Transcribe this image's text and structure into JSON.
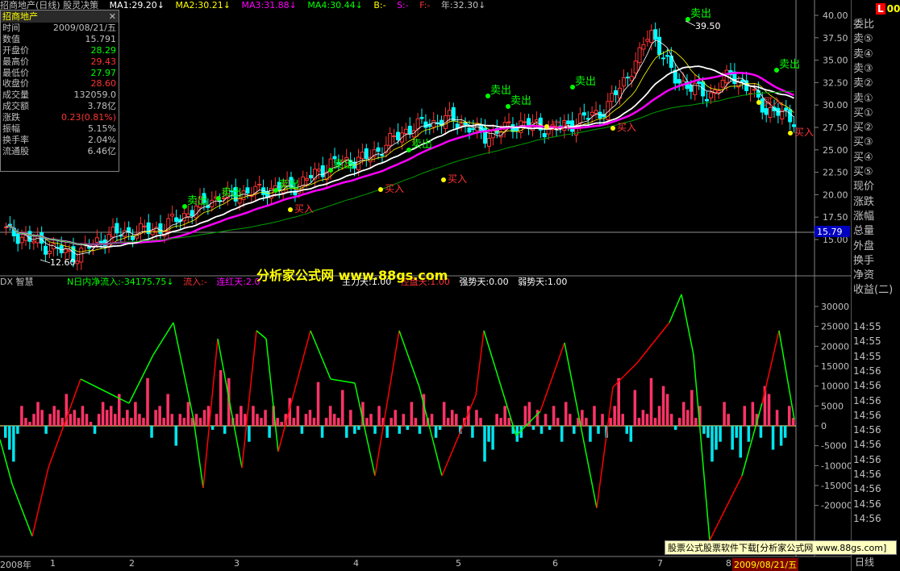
{
  "topbar": {
    "title": "招商地产(日线) 股灵决策",
    "ma1": "MA1:29.20↓",
    "ma2": "MA2:30.21↓",
    "ma3": "MA3:31.88↓",
    "ma4": "MA4:30.44↓",
    "b": "B:-",
    "s": "S:-",
    "f": "F:-",
    "year": "年:32.30↓"
  },
  "colors": {
    "ma1": "#ffffff",
    "ma2": "#ffff00",
    "ma3": "#ff00ff",
    "ma4": "#00ff00",
    "up": "#ff3333",
    "down": "#00ffff",
    "sell_label": "#00ff00",
    "buy_label": "#ff3333"
  },
  "info_panel": {
    "title": "招商地产",
    "close_icon": "close-icon",
    "rows": [
      {
        "label": "时间",
        "value": "2009/08/21/五",
        "color": "#c0c0c0"
      },
      {
        "label": "数值",
        "value": "15.791",
        "color": "#c0c0c0"
      },
      {
        "label": "开盘价",
        "value": "28.29",
        "color": "#00ff00"
      },
      {
        "label": "最高价",
        "value": "29.43",
        "color": "#ff3333"
      },
      {
        "label": "最低价",
        "value": "27.97",
        "color": "#00ff00"
      },
      {
        "label": "收盘价",
        "value": "28.60",
        "color": "#ff3333"
      },
      {
        "label": "成交量",
        "value": "132059.0",
        "color": "#c0c0c0"
      },
      {
        "label": "成交额",
        "value": "3.78亿",
        "color": "#c0c0c0"
      },
      {
        "label": "涨跌",
        "value": "0.23(0.81%)",
        "color": "#ff3333"
      },
      {
        "label": "振幅",
        "value": "5.15%",
        "color": "#c0c0c0"
      },
      {
        "label": "换手率",
        "value": "2.04%",
        "color": "#c0c0c0"
      },
      {
        "label": "流通股",
        "value": "6.46亿",
        "color": "#c0c0c0"
      }
    ]
  },
  "right_panel": {
    "top_label": "00",
    "items": [
      "委比",
      "卖⑤",
      "卖④",
      "卖③",
      "卖②",
      "卖①",
      "买①",
      "买②",
      "买③",
      "买④",
      "买⑤",
      "现价",
      "涨跌",
      "涨幅",
      "总量",
      "外盘",
      "换手",
      "净资",
      "收益(二)"
    ],
    "times": [
      "14:55",
      "14:55",
      "14:55",
      "14:56",
      "14:56",
      "14:56",
      "14:56",
      "14:56",
      "14:56",
      "14:56",
      "14:56",
      "14:56",
      "14:56",
      "14:56"
    ],
    "bottom": "日线"
  },
  "price_axis": {
    "ticks": [
      "40.00",
      "37.50",
      "35.00",
      "32.50",
      "30.00",
      "27.50",
      "25.00",
      "22.50",
      "20.00",
      "17.50",
      "15.00"
    ],
    "current": "15.79"
  },
  "flow_axis": {
    "ticks": [
      "30000",
      "25000",
      "20000",
      "15000",
      "10000",
      "5000",
      "0",
      "-5000",
      "-10000",
      "-15000",
      "-20000"
    ]
  },
  "price_chart": {
    "high_label": "39.50",
    "low_label": "12.60",
    "sell_text": "卖出",
    "buy_text": "买入",
    "price_min": 12.6,
    "price_max": 40.0
  },
  "dx_panel": {
    "name": "DX 智慧",
    "n_flow": "N日内净流入:-34175.75↓",
    "inflow": "流入:-",
    "red_days": "连红天:2.0",
    "main_force": "主力天:1.00",
    "ctrl_days": "控盘天:1.00",
    "strong_days": "强势天:0.00",
    "weak_days": "弱势天:1.00"
  },
  "watermark": "分析家公式网 www.88gs.com",
  "footer_ad": "股票公式股票软件下载[分析家公式网 www.88gs.com]",
  "x_axis": {
    "labels": [
      "2008年",
      "1",
      "2",
      "3",
      "4",
      "5",
      "6",
      "7",
      "8",
      "2009/08/21/五"
    ]
  },
  "chart_data": {
    "type": "bar",
    "title": "",
    "categories": [],
    "series": [
      {
        "name": "流入",
        "values": [
          -3000,
          -6000,
          -9000,
          -2000,
          5000,
          2000,
          1000,
          3000,
          6000,
          4000,
          -2000,
          3000,
          5000,
          4000,
          2000,
          8000,
          3000,
          4000,
          2000,
          5000,
          3000,
          1000,
          -2000,
          3000,
          6000,
          4000,
          5000,
          3000,
          8000,
          2000,
          4000,
          2000,
          6000,
          3000,
          2000,
          12000,
          -3000,
          4000,
          5000,
          2000,
          8000,
          3000,
          -5000,
          3000,
          2000,
          6000,
          2000,
          3000,
          2000,
          4000,
          5000,
          -1000,
          3000,
          14000,
          -2000,
          12000,
          2000,
          3000,
          5000,
          3000,
          -4000,
          5000,
          3000,
          2000,
          4000,
          -3000,
          5000,
          2000,
          1000,
          3000,
          7000,
          2000,
          5000,
          -2000,
          3000,
          4000,
          2000,
          11000,
          -3000,
          2000,
          5000,
          3000,
          2000,
          9000,
          -3000,
          4000,
          -2000,
          -1000,
          6000,
          2000,
          3000,
          -2000,
          5000,
          2000,
          -3000,
          2000,
          4000,
          -2000,
          3000,
          -1000,
          6000,
          2000,
          -2000,
          8000,
          2000,
          3000,
          -3000,
          -1000,
          6000,
          2000,
          4000,
          3000,
          -2000,
          2000,
          5000,
          -3000,
          4000,
          2000,
          -9000,
          -4000,
          -6000,
          3000,
          2000,
          5000,
          2000,
          -2000,
          -4000,
          -3000,
          5000,
          6000,
          -1000,
          4000,
          -2000,
          3000,
          -1000,
          5000,
          2000,
          -4000,
          6000,
          3000,
          -2000,
          2000,
          4000,
          2000,
          -4000,
          5000,
          -2000,
          3000,
          -3000,
          2000,
          5000,
          12000,
          3000,
          -2000,
          -4000,
          9000,
          2000,
          4000,
          3000,
          12000,
          2000,
          5000,
          10000,
          8000,
          3000,
          -1000,
          2000,
          6000,
          4000,
          9000,
          2000,
          5000,
          -2000,
          -3000,
          -9000,
          -6000,
          -4000,
          6000,
          3000,
          -6000,
          -3000,
          -8000,
          5000,
          -4000,
          6000,
          3000,
          -3000,
          10000,
          8000,
          -6000,
          4000,
          -5000,
          -3000,
          5000,
          2000
        ]
      }
    ]
  }
}
